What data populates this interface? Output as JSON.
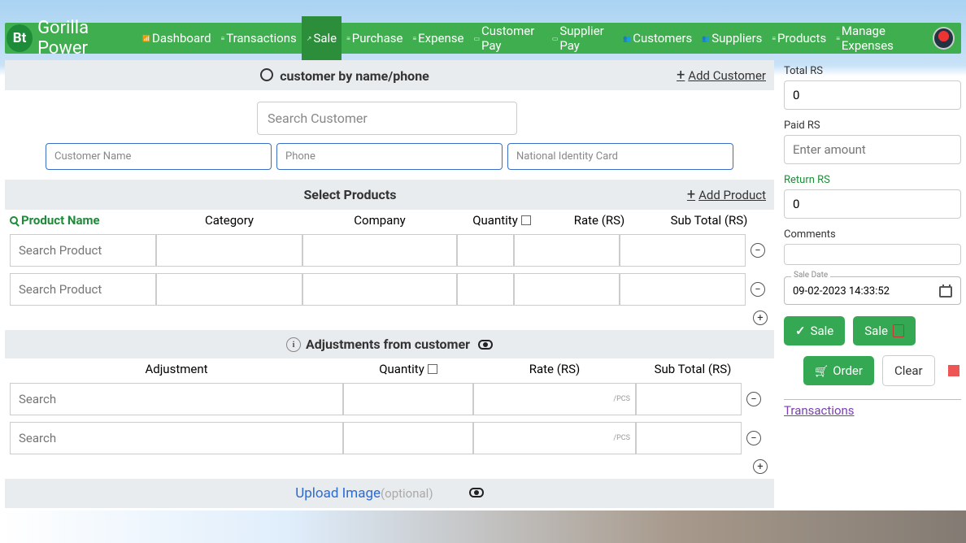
{
  "brand": {
    "logo_text": "Bt",
    "title": "Gorilla Power"
  },
  "nav": {
    "items": [
      {
        "label": "Dashboard"
      },
      {
        "label": "Transactions"
      },
      {
        "label": "Sale"
      },
      {
        "label": "Purchase"
      },
      {
        "label": "Expense"
      },
      {
        "label": "Customer Pay"
      },
      {
        "label": "Supplier Pay"
      },
      {
        "label": "Customers"
      },
      {
        "label": "Suppliers"
      },
      {
        "label": "Products"
      },
      {
        "label": "Manage Expenses"
      }
    ],
    "active_index": 2
  },
  "customer_section": {
    "header": "customer by name/phone",
    "add_link": "Add Customer",
    "search_placeholder": "Search Customer",
    "fields": {
      "name_placeholder": "Customer Name",
      "phone_placeholder": "Phone",
      "nic_placeholder": "National Identity Card"
    }
  },
  "products_section": {
    "header": "Select Products",
    "add_link": "Add Product",
    "columns": {
      "name": "Product Name",
      "category": "Category",
      "company": "Company",
      "quantity": "Quantity",
      "rate": "Rate (RS)",
      "subtotal": "Sub Total (RS)"
    },
    "search_placeholder": "Search Product",
    "rows": [
      {},
      {}
    ]
  },
  "adjustments_section": {
    "header": "Adjustments from customer",
    "columns": {
      "adjustment": "Adjustment",
      "quantity": "Quantity",
      "rate": "Rate (RS)",
      "subtotal": "Sub Total (RS)"
    },
    "search_placeholder": "Search",
    "unit_suffix": "/PCS",
    "rows": [
      {},
      {}
    ]
  },
  "upload": {
    "link": "Upload Image",
    "optional": "(optional)"
  },
  "right": {
    "total_label": "Total RS",
    "total_value": "0",
    "paid_label": "Paid RS",
    "paid_placeholder": "Enter amount",
    "return_label": "Return RS",
    "return_value": "0",
    "comments_label": "Comments",
    "sale_date_label": "Sale Date",
    "sale_date_value": "09-02-2023 14:33:52",
    "buttons": {
      "sale": "Sale",
      "sale_pdf": "Sale",
      "order": "Order",
      "clear": "Clear"
    },
    "transactions_link": "Transactions"
  }
}
